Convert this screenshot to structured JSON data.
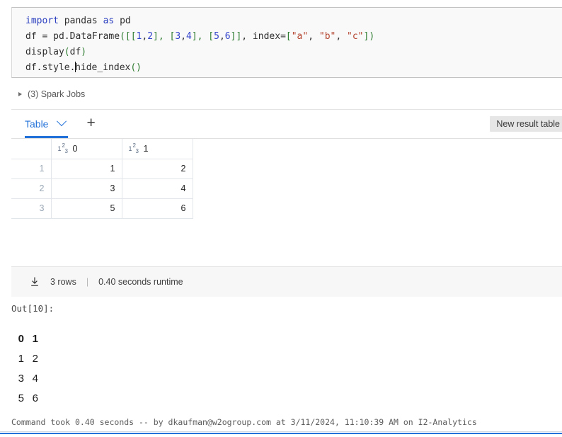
{
  "code_cell": {
    "lines": [
      [
        {
          "t": "import",
          "c": "kw"
        },
        {
          "t": " pandas ",
          "c": "plain"
        },
        {
          "t": "as",
          "c": "kw"
        },
        {
          "t": " pd",
          "c": "plain"
        }
      ],
      [
        {
          "t": "df = pd.DataFrame",
          "c": "plain"
        },
        {
          "t": "([[",
          "c": "brk"
        },
        {
          "t": "1",
          "c": "num"
        },
        {
          "t": ",",
          "c": "plain"
        },
        {
          "t": "2",
          "c": "num"
        },
        {
          "t": "], [",
          "c": "brk"
        },
        {
          "t": "3",
          "c": "num"
        },
        {
          "t": ",",
          "c": "plain"
        },
        {
          "t": "4",
          "c": "num"
        },
        {
          "t": "], [",
          "c": "brk"
        },
        {
          "t": "5",
          "c": "num"
        },
        {
          "t": ",",
          "c": "plain"
        },
        {
          "t": "6",
          "c": "num"
        },
        {
          "t": "]]",
          "c": "brk"
        },
        {
          "t": ", index=",
          "c": "plain"
        },
        {
          "t": "[",
          "c": "brk"
        },
        {
          "t": "\"a\"",
          "c": "str"
        },
        {
          "t": ", ",
          "c": "plain"
        },
        {
          "t": "\"b\"",
          "c": "str"
        },
        {
          "t": ", ",
          "c": "plain"
        },
        {
          "t": "\"c\"",
          "c": "str"
        },
        {
          "t": "])",
          "c": "brk"
        }
      ],
      [
        {
          "t": "display",
          "c": "plain"
        },
        {
          "t": "(",
          "c": "brk"
        },
        {
          "t": "df",
          "c": "plain"
        },
        {
          "t": ")",
          "c": "brk"
        }
      ],
      [
        {
          "t": "df.style.",
          "c": "plain"
        },
        {
          "t": "",
          "c": "caret"
        },
        {
          "t": "hide_index",
          "c": "plain"
        },
        {
          "t": "()",
          "c": "brk"
        }
      ]
    ]
  },
  "spark_jobs": {
    "label": "(3) Spark Jobs",
    "expander_icon": "triangle-right-icon"
  },
  "result_panel": {
    "tab_label": "Table",
    "tab_chevron_icon": "chevron-down-icon",
    "add_tab_icon": "plus-icon",
    "add_tab_label": "+",
    "tooltip": "New result table",
    "table": {
      "index_header": "",
      "columns": [
        {
          "name": "0",
          "type_icon": "number-type-icon"
        },
        {
          "name": "1",
          "type_icon": "number-type-icon"
        }
      ],
      "rows": [
        {
          "index": "1",
          "cells": [
            "1",
            "2"
          ]
        },
        {
          "index": "2",
          "cells": [
            "3",
            "4"
          ]
        },
        {
          "index": "3",
          "cells": [
            "5",
            "6"
          ]
        }
      ]
    },
    "footer": {
      "download_icon": "download-icon",
      "rows_text": "3 rows",
      "separator": "|",
      "runtime_text": "0.40 seconds runtime"
    }
  },
  "output": {
    "label": "Out[10]:",
    "styler_table": {
      "headers": [
        "0",
        "1"
      ],
      "rows": [
        [
          "1",
          "2"
        ],
        [
          "3",
          "4"
        ],
        [
          "5",
          "6"
        ]
      ]
    }
  },
  "command_footer": {
    "text": "Command took 0.40 seconds -- by dkaufman@w2ogroup.com at 3/11/2024, 11:10:39 AM on I2-Analytics"
  },
  "colors": {
    "accent": "#2272d9",
    "keyword": "#2c40c0",
    "string": "#b4442f",
    "bracket": "#2f7d32",
    "number": "#3344cc",
    "index_text": "#9aa7b5",
    "code_bg": "#f9f9f9",
    "footer_bg": "#f7f7f8"
  }
}
